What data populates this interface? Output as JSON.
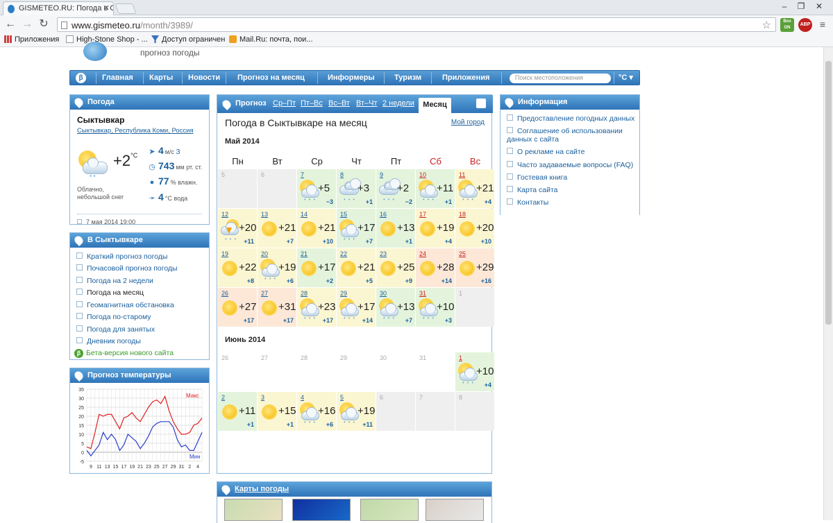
{
  "browser": {
    "tab_title": "GISMETEO.RU: Погода в С",
    "url_host": "www.gismeteo.ru",
    "url_path": "/month/3989/",
    "bookmarks": [
      {
        "label": "Приложения"
      },
      {
        "label": "High-Stone Shop - ..."
      },
      {
        "label": "Доступ ограничен"
      },
      {
        "label": "Mail.Ru: почта, пои..."
      }
    ],
    "ext_box": "Box ON",
    "ext_abp": "ABP",
    "new_tab_icon": "new-tab-icon"
  },
  "header": {
    "logo_subtitle": "прогноз погоды",
    "beta": "β",
    "nav": [
      "Главная",
      "Карты",
      "Новости",
      "Прогноз на месяц",
      "Информеры",
      "Туризм",
      "Приложения"
    ],
    "search_placeholder": "Поиск местоположения",
    "unit": "°C ▾"
  },
  "now": {
    "panel_title": "Погода",
    "city": "Сыктывкар",
    "region": [
      "Сыктывкар",
      "Республика Коми",
      "Россия"
    ],
    "temp": "+2",
    "temp_unit": "°C",
    "desc": "Облачно, небольшой снег",
    "wind_value": "4",
    "wind_unit": "м/с",
    "wind_dir": "З",
    "pressure_value": "743",
    "pressure_unit": "мм рт. ст.",
    "humidity_value": "77",
    "humidity_unit": "% влажн.",
    "water_value": "4",
    "water_unit": "°C вода",
    "date": "7 мая 2014 19:00"
  },
  "in_city": {
    "panel_title": "В Сыктывкаре",
    "links": [
      "Краткий прогноз погоды",
      "Почасовой прогноз погоды",
      "Погода на 2 недели",
      "Погода на месяц",
      "Геомагнитная обстановка",
      "Погода по-старому",
      "Погода для занятых",
      "Дневник погоды"
    ],
    "current": "Погода на месяц",
    "beta_link": "Бета-версия нового сайта"
  },
  "temp_chart_panel": {
    "panel_title": "Прогноз температуры",
    "label_max": "Макс",
    "label_min": "Мин"
  },
  "chart_data": {
    "type": "line",
    "x": [
      8,
      9,
      10,
      11,
      12,
      13,
      14,
      15,
      16,
      17,
      18,
      19,
      20,
      21,
      22,
      23,
      24,
      25,
      26,
      27,
      28,
      29,
      30,
      31,
      1,
      2,
      3,
      4,
      5
    ],
    "tick_labels": [
      "9",
      "11",
      "13",
      "15",
      "17",
      "19",
      "21",
      "23",
      "25",
      "27",
      "29",
      "31",
      "2",
      "4"
    ],
    "yticks": [
      35,
      30,
      25,
      20,
      15,
      10,
      5,
      0,
      -5
    ],
    "ylim": [
      -5,
      35
    ],
    "grid": true,
    "series": [
      {
        "name": "Макс",
        "color": "#e02020",
        "values": [
          3,
          2,
          11,
          21,
          20,
          21,
          21,
          17,
          13,
          19,
          20,
          22,
          19,
          17,
          21,
          25,
          28,
          29,
          27,
          31,
          23,
          17,
          13,
          10,
          10,
          11,
          15,
          16,
          19
        ]
      },
      {
        "name": "Мин",
        "color": "#2a3fc8",
        "values": [
          1,
          -2,
          1,
          4,
          11,
          7,
          10,
          7,
          1,
          4,
          10,
          8,
          6,
          2,
          5,
          9,
          14,
          16,
          17,
          17,
          17,
          14,
          7,
          3,
          4,
          1,
          1,
          6,
          11
        ]
      }
    ]
  },
  "calendar": {
    "tabs_label": "Прогноз",
    "tabs": [
      "Ср–Пт",
      "Пт–Вс",
      "Вс–Вт",
      "Вт–Чт",
      "2 недели"
    ],
    "active_tab": "Месяц",
    "title": "Погода в Сыктывкаре на месяц",
    "my_city": "Мой город",
    "month1": "Май 2014",
    "month2": "Июнь 2014",
    "dow": [
      "Пн",
      "Вт",
      "Ср",
      "Чт",
      "Пт",
      "Сб",
      "Вс"
    ],
    "may": [
      {
        "d": "5"
      },
      {
        "d": "6"
      },
      {
        "d": "7",
        "hi": "+5",
        "lo": "−3",
        "ic": "psnow",
        "bg": "green"
      },
      {
        "d": "8",
        "hi": "+3",
        "lo": "+1",
        "ic": "cloudsnow",
        "bg": "green"
      },
      {
        "d": "9",
        "hi": "+2",
        "lo": "−2",
        "ic": "cloudsnow",
        "bg": "green"
      },
      {
        "d": "10",
        "hi": "+11",
        "lo": "+1",
        "ic": "psnow",
        "bg": "green",
        "we": true
      },
      {
        "d": "11",
        "hi": "+21",
        "lo": "+4",
        "ic": "psnow",
        "bg": "yellow",
        "we": true
      },
      {
        "d": "12",
        "hi": "+20",
        "lo": "+11",
        "ic": "storm",
        "bg": "yellow"
      },
      {
        "d": "13",
        "hi": "+21",
        "lo": "+7",
        "ic": "sun",
        "bg": "yellow"
      },
      {
        "d": "14",
        "hi": "+21",
        "lo": "+10",
        "ic": "sun",
        "bg": "yellow"
      },
      {
        "d": "15",
        "hi": "+17",
        "lo": "+7",
        "ic": "psnow",
        "bg": "green"
      },
      {
        "d": "16",
        "hi": "+13",
        "lo": "+1",
        "ic": "sun",
        "bg": "green"
      },
      {
        "d": "17",
        "hi": "+19",
        "lo": "+4",
        "ic": "sun",
        "bg": "yellow",
        "we": true
      },
      {
        "d": "18",
        "hi": "+20",
        "lo": "+10",
        "ic": "sun",
        "bg": "yellow",
        "we": true
      },
      {
        "d": "19",
        "hi": "+22",
        "lo": "+8",
        "ic": "sun",
        "bg": "yellow"
      },
      {
        "d": "20",
        "hi": "+19",
        "lo": "+6",
        "ic": "psnow",
        "bg": "yellow"
      },
      {
        "d": "21",
        "hi": "+17",
        "lo": "+2",
        "ic": "sun",
        "bg": "green"
      },
      {
        "d": "22",
        "hi": "+21",
        "lo": "+5",
        "ic": "sun",
        "bg": "yellow"
      },
      {
        "d": "23",
        "hi": "+25",
        "lo": "+9",
        "ic": "sun",
        "bg": "yellow"
      },
      {
        "d": "24",
        "hi": "+28",
        "lo": "+14",
        "ic": "sun",
        "bg": "orange",
        "we": true
      },
      {
        "d": "25",
        "hi": "+29",
        "lo": "+16",
        "ic": "sun",
        "bg": "orange",
        "we": true
      },
      {
        "d": "26",
        "hi": "+27",
        "lo": "+17",
        "ic": "sun",
        "bg": "orange"
      },
      {
        "d": "27",
        "hi": "+31",
        "lo": "+17",
        "ic": "sun",
        "bg": "orange"
      },
      {
        "d": "28",
        "hi": "+23",
        "lo": "+17",
        "ic": "psnow",
        "bg": "yellow"
      },
      {
        "d": "29",
        "hi": "+17",
        "lo": "+14",
        "ic": "psnow",
        "bg": "yellow"
      },
      {
        "d": "30",
        "hi": "+13",
        "lo": "+7",
        "ic": "psnow",
        "bg": "green"
      },
      {
        "d": "31",
        "hi": "+10",
        "lo": "+3",
        "ic": "psnow",
        "bg": "green",
        "we": true
      },
      {
        "d": "1"
      }
    ],
    "june_pre": [
      "26",
      "27",
      "28",
      "29",
      "30",
      "31"
    ],
    "june": [
      {
        "d": "1",
        "hi": "+10",
        "lo": "+4",
        "ic": "psnow",
        "bg": "green",
        "we": true
      },
      {
        "d": "2",
        "hi": "+11",
        "lo": "+1",
        "ic": "sun",
        "bg": "green"
      },
      {
        "d": "3",
        "hi": "+15",
        "lo": "+1",
        "ic": "sun",
        "bg": "yellow"
      },
      {
        "d": "4",
        "hi": "+16",
        "lo": "+6",
        "ic": "psnow",
        "bg": "yellow"
      },
      {
        "d": "5",
        "hi": "+19",
        "lo": "+11",
        "ic": "psnow",
        "bg": "yellow"
      },
      {
        "d": "6"
      },
      {
        "d": "7"
      },
      {
        "d": "8"
      }
    ]
  },
  "info": {
    "panel_title": "Информация",
    "links": [
      "Предоставление погодных данных",
      "Соглашение об использовании данных с сайта",
      "О рекламе на сайте",
      "Часто задаваемые вопросы (FAQ)",
      "Гостевая книга",
      "Карта сайта",
      "Контакты"
    ]
  },
  "maps": {
    "panel_title": "Карты погоды"
  }
}
